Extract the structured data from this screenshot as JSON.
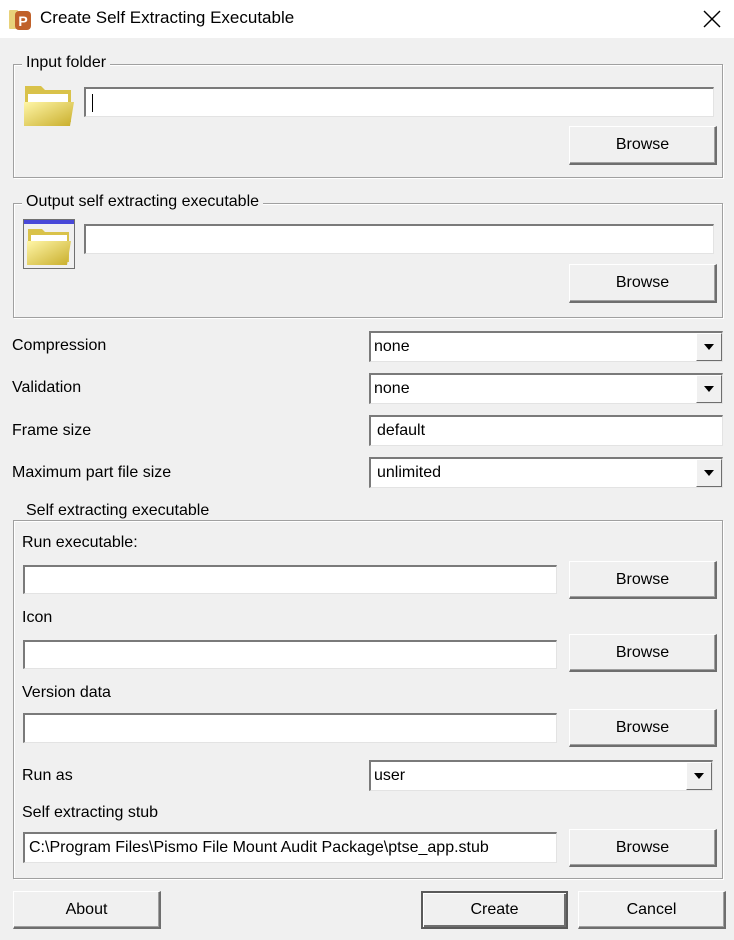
{
  "window": {
    "title": "Create Self Extracting Executable",
    "app_icon": "pismo-p-icon",
    "close_icon": "close-icon"
  },
  "input_folder": {
    "group_label": "Input folder",
    "icon": "open-folder-icon",
    "value": "",
    "browse_label": "Browse"
  },
  "output_exe": {
    "group_label": "Output self extracting executable",
    "icon": "open-folder-window-icon",
    "value": "",
    "browse_label": "Browse"
  },
  "options": {
    "compression": {
      "label": "Compression",
      "value": "none"
    },
    "validation": {
      "label": "Validation",
      "value": "none"
    },
    "frame_size": {
      "label": "Frame size",
      "value": "default"
    },
    "max_part_size": {
      "label": "Maximum part file size",
      "value": "unlimited"
    }
  },
  "self_extracting": {
    "group_label": "Self extracting executable",
    "run_executable": {
      "label": "Run executable:",
      "value": "",
      "browse_label": "Browse"
    },
    "icon": {
      "label": "Icon",
      "value": "",
      "browse_label": "Browse"
    },
    "version_data": {
      "label": "Version data",
      "value": "",
      "browse_label": "Browse"
    },
    "run_as": {
      "label": "Run as",
      "value": "user"
    },
    "stub": {
      "label": "Self extracting stub",
      "value": "C:\\Program Files\\Pismo File Mount Audit Package\\ptse_app.stub",
      "browse_label": "Browse"
    }
  },
  "footer": {
    "about_label": "About",
    "create_label": "Create",
    "cancel_label": "Cancel"
  }
}
